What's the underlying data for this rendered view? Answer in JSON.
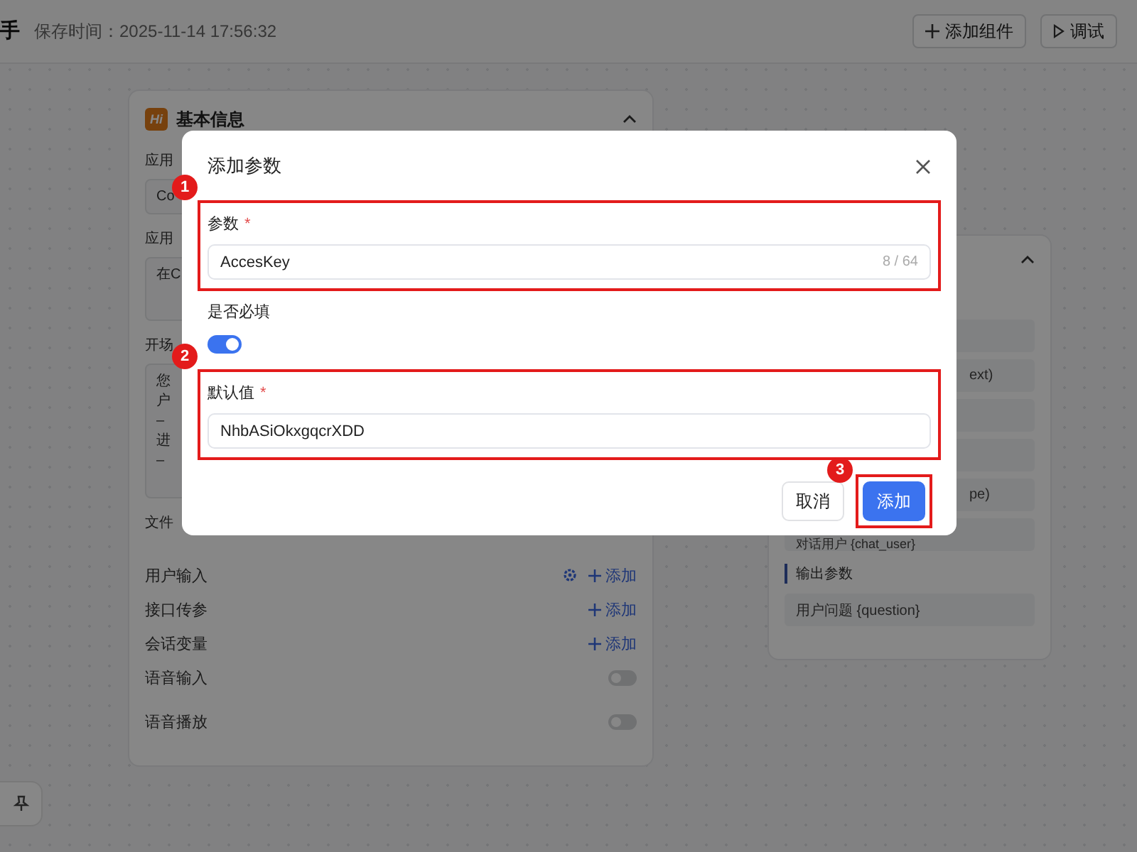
{
  "header": {
    "title_fragment": "手",
    "save_time": "保存时间：2025-11-14 17:56:32",
    "buttons": [
      {
        "label": "添加组件"
      },
      {
        "label": "调试"
      }
    ]
  },
  "basic_info": {
    "badge": "Hi",
    "title": "基本信息",
    "expanded": true,
    "fields": [
      {
        "kind": "label",
        "text": "应用"
      },
      {
        "kind": "input",
        "lines": [
          "Co"
        ]
      },
      {
        "kind": "label",
        "text": "应用"
      },
      {
        "kind": "textarea",
        "lines": [
          "在C"
        ]
      },
      {
        "kind": "label",
        "text": "开场"
      },
      {
        "kind": "textarea",
        "lines": [
          "您",
          "户",
          "–",
          "进",
          "–"
        ]
      },
      {
        "kind": "label",
        "text": "文件"
      }
    ],
    "rows": [
      {
        "kind": "add",
        "label": "用户输入",
        "settings": true,
        "action": "添加"
      },
      {
        "kind": "add",
        "label": "接口传参",
        "settings": false,
        "action": "添加"
      },
      {
        "kind": "add",
        "label": "会话变量",
        "settings": false,
        "action": "添加"
      },
      {
        "kind": "switch",
        "label": "语音输入",
        "on": false
      },
      {
        "kind": "switch",
        "label": "语音播放",
        "on": false
      }
    ]
  },
  "variables_panel": {
    "expanded": true,
    "items": [
      {
        "kind": "blank"
      },
      {
        "kind": "cut",
        "text": "ext)"
      },
      {
        "kind": "blank"
      },
      {
        "kind": "blank"
      },
      {
        "kind": "cut",
        "text": "pe)"
      },
      {
        "kind": "full",
        "text": "对话用户 {chat_user}"
      }
    ],
    "output_title": "输出参数",
    "outputs": [
      "用户问题 {question}"
    ]
  },
  "dialog": {
    "title": "添加参数",
    "items": [
      {
        "kind": "field",
        "label": "参数",
        "required_mark": "*",
        "value": "AccesKey",
        "counter": "8 / 64",
        "marker": "1"
      },
      {
        "kind": "switch",
        "label": "是否必填",
        "on": true
      },
      {
        "kind": "field",
        "label": "默认值",
        "required_mark": "*",
        "value": "NhbASiOkxgqcrXDD",
        "marker": "2"
      }
    ],
    "buttons": [
      {
        "kind": "default",
        "label": "取消"
      },
      {
        "kind": "primary",
        "label": "添加",
        "marker": "3"
      }
    ]
  }
}
